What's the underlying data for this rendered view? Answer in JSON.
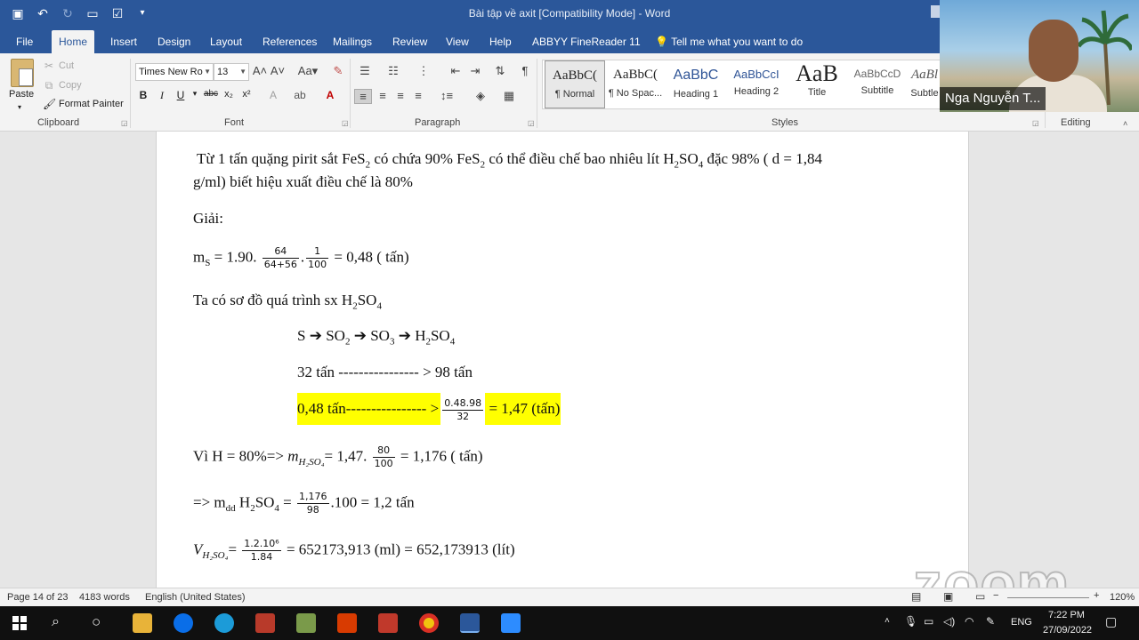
{
  "window": {
    "title": "Bài tập về axit [Compatibility Mode]  -  Word"
  },
  "tabs": [
    "File",
    "Home",
    "Insert",
    "Design",
    "Layout",
    "References",
    "Mailings",
    "Review",
    "View",
    "Help",
    "ABBYY FineReader 11"
  ],
  "tell_me": "Tell me what you want to do",
  "ribbon": {
    "clipboard": {
      "paste": "Paste",
      "cut": "Cut",
      "copy": "Copy",
      "format_painter": "Format Painter",
      "label": "Clipboard"
    },
    "font": {
      "family": "Times New Ro",
      "size": "13",
      "label": "Font",
      "bold": "B",
      "italic": "I",
      "underline": "U",
      "strike": "abc",
      "subscript": "x₂",
      "superscript": "x²"
    },
    "paragraph": {
      "label": "Paragraph"
    },
    "styles": {
      "label": "Styles",
      "items": [
        {
          "sample": "AaBbC(",
          "name": "¶ Normal"
        },
        {
          "sample": "AaBbC(",
          "name": "¶ No Spac..."
        },
        {
          "sample": "AaBbC",
          "name": "Heading 1"
        },
        {
          "sample": "AaBbCcI",
          "name": "Heading 2"
        },
        {
          "sample": "AaB",
          "name": "Title"
        },
        {
          "sample": "AaBbCcD",
          "name": "Subtitle"
        },
        {
          "sample": "AaBl",
          "name": "Subtle"
        }
      ]
    },
    "editing": {
      "label": "Editing"
    }
  },
  "video": {
    "name": "Nga Nguyễn T..."
  },
  "document": {
    "l1a": "Từ 1 tấn quặng pirit sắt FeS",
    "l1b": " có chứa 90% FeS",
    "l1c": " có thể điều chế bao nhiêu lít H",
    "l1d": "SO",
    "l1e": " đặc 98% ( d = 1,84",
    "l2": "g/ml) biết hiệu xuất điều chế là 80%",
    "giai": "Giải:",
    "ms_a": "m",
    "ms_sub": "S",
    "ms_b": " =  1.90.",
    "f1_num": "64",
    "f1_den": "64+56",
    "f2_num": "1",
    "f2_den": "100",
    "ms_c": "= 0,48 ( tấn)",
    "sodo_a": "Ta có sơ đồ quá trình sx H",
    "sodo_b": "SO",
    "chain_a": "S ",
    "chain_arrow": "➔",
    "chain_b": " SO",
    "chain_c": " SO",
    "chain_d": " H",
    "chain_e": "SO",
    "ratio": "32 tấn ---------------- > 98 tấn",
    "hl_a": "0,48 tấn---------------- >",
    "f3_num": "0.48.98",
    "f3_den": "32",
    "hl_b": " = 1,47 (tấn)",
    "h_a": "Vì H = 80%=> ",
    "h_m": "m",
    "h_sub": "H₂SO₄",
    "h_b": "= 1,47.",
    "f4_num": "80",
    "f4_den": "100",
    "h_c": "= 1,176 ( tấn)",
    "mdd_a": "=> m",
    "mdd_sub": "dd",
    "mdd_b": " H",
    "mdd_c": "SO",
    "mdd_d": " =",
    "f5_num": "1,176",
    "f5_den": "98",
    "mdd_e": ".100 = 1,2 tấn",
    "v_a": "V",
    "v_sub": "H₂SO₄",
    "v_b": "=",
    "f6_num": "1.2.10⁶",
    "f6_den": "1.84",
    "v_c": "= 652173,913 (ml) = 652,173913 (lít)",
    "sub2": "2",
    "sub3": "3",
    "sub4": "4"
  },
  "status": {
    "page": "Page 14 of 23",
    "words": "4183 words",
    "language": "English (United States)",
    "zoom": "120%"
  },
  "watermark": "zoom",
  "taskbar": {
    "lang": "ENG",
    "time": "7:22 PM",
    "date": "27/09/2022"
  }
}
